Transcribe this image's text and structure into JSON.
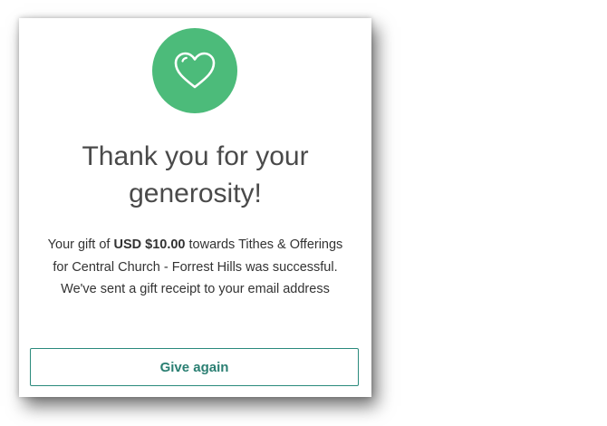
{
  "confirmation": {
    "icon": "heart-icon",
    "accent_color": "#4cbb7a",
    "title_line1": "Thank you for your",
    "title_line2": "generosity!",
    "message": {
      "gift_prefix": "Your gift of ",
      "amount": "USD $10.00",
      "gift_suffix": " towards Tithes & Offerings",
      "line2": "for Central Church - Forrest Hills was successful.",
      "line3": "We've sent a gift receipt to your email address"
    },
    "button_label": "Give again",
    "button_color": "#2a7f72"
  }
}
